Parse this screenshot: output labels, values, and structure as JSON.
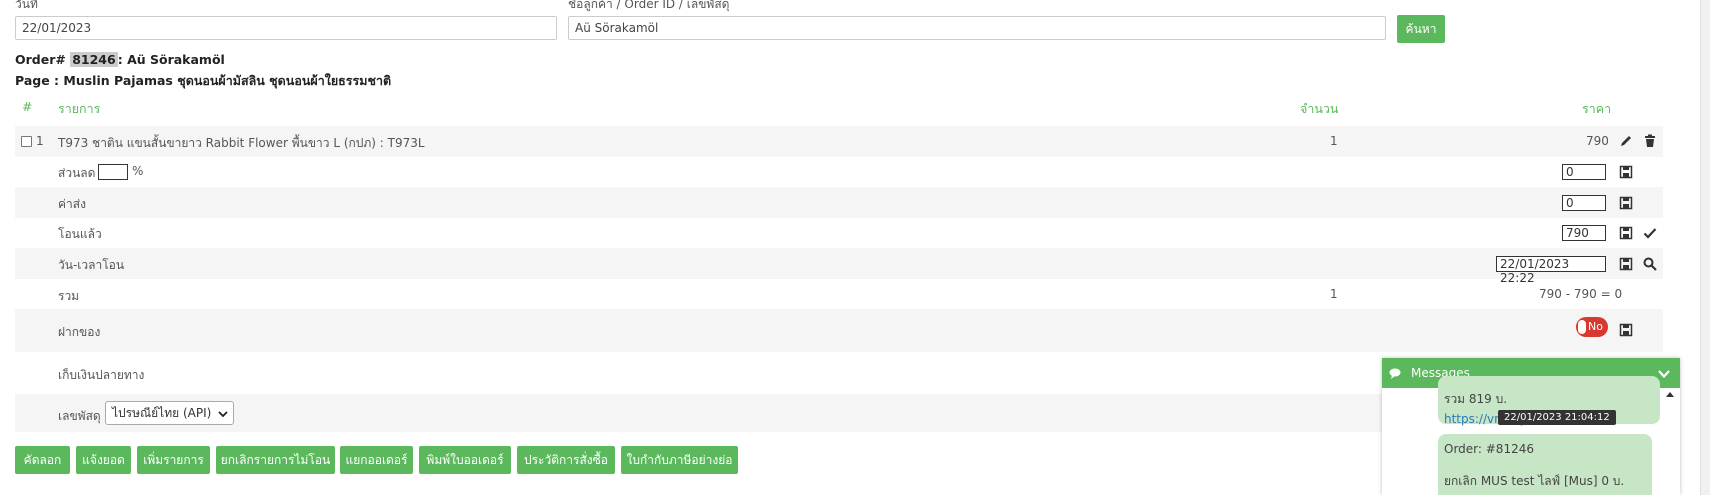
{
  "filter": {
    "date_label": "วันที่",
    "date_value": "22/01/2023",
    "search_label": "ชื่อลูกค้า / Order ID / เลขพัสดุ",
    "search_value": "Aü Sörakamöl",
    "search_button": "ค้นหา"
  },
  "order": {
    "prefix": "Order#",
    "id": "81246",
    "customer": ": Aü Sörakamöl",
    "page_line": "Page : Muslin Pajamas ชุดนอนผ้ามัสลิน ชุดนอนผ้าใยธรรมชาติ"
  },
  "table": {
    "headers": {
      "num": "#",
      "item": "รายการ",
      "qty": "จำนวน",
      "price": "ราคา"
    },
    "item": {
      "index": "1",
      "name": "T973 ชาติน แขนสั้นขายาว Rabbit Flower พื้นขาว L (กปภ) : T973L",
      "qty": "1",
      "price": "790"
    },
    "discount": {
      "label": "ส่วนลด",
      "percent_sign": "%",
      "percent_value": "",
      "value": "0"
    },
    "shipping": {
      "label": "ค่าส่ง",
      "value": "0"
    },
    "paid": {
      "label": "โอนแล้ว",
      "value": "790"
    },
    "transfer_time": {
      "label": "วัน-เวลาโอน",
      "value": "22/01/2023 22:22"
    },
    "total": {
      "label": "รวม",
      "qty": "1",
      "value": "790 - 790 = 0"
    },
    "deposit": {
      "label": "ฝากของ",
      "toggle": "No"
    },
    "cod": {
      "label": "เก็บเงินปลายทาง"
    },
    "tracking": {
      "label": "เลขพัสดุ",
      "carrier": "ไปรษณีย์ไทย (API)"
    }
  },
  "actions": [
    "คัดลอก",
    "แจ้งยอด",
    "เพิ่มรายการ",
    "ยกเลิกรายการไม่โอน",
    "แยกออเดอร์",
    "พิมพ์ใบออเดอร์",
    "ประวัติการสั่งซื้อ",
    "ใบกำกับภาษีอย่างย่อ"
  ],
  "messages": {
    "title": "Messages",
    "bubble1_line1": "รวม 819 บ.",
    "bubble1_link": "https://vr.../SjRPt1Wf...",
    "tooltip": "22/01/2023 21:04:12",
    "bubble2_line1": "Order: #81246",
    "bubble2_line2": "ยกเลิก MUS test ไลฟ์ [Mus] 0 บ."
  },
  "colors": {
    "accent": "#5cb85c",
    "toggle_off": "#d9382f"
  }
}
